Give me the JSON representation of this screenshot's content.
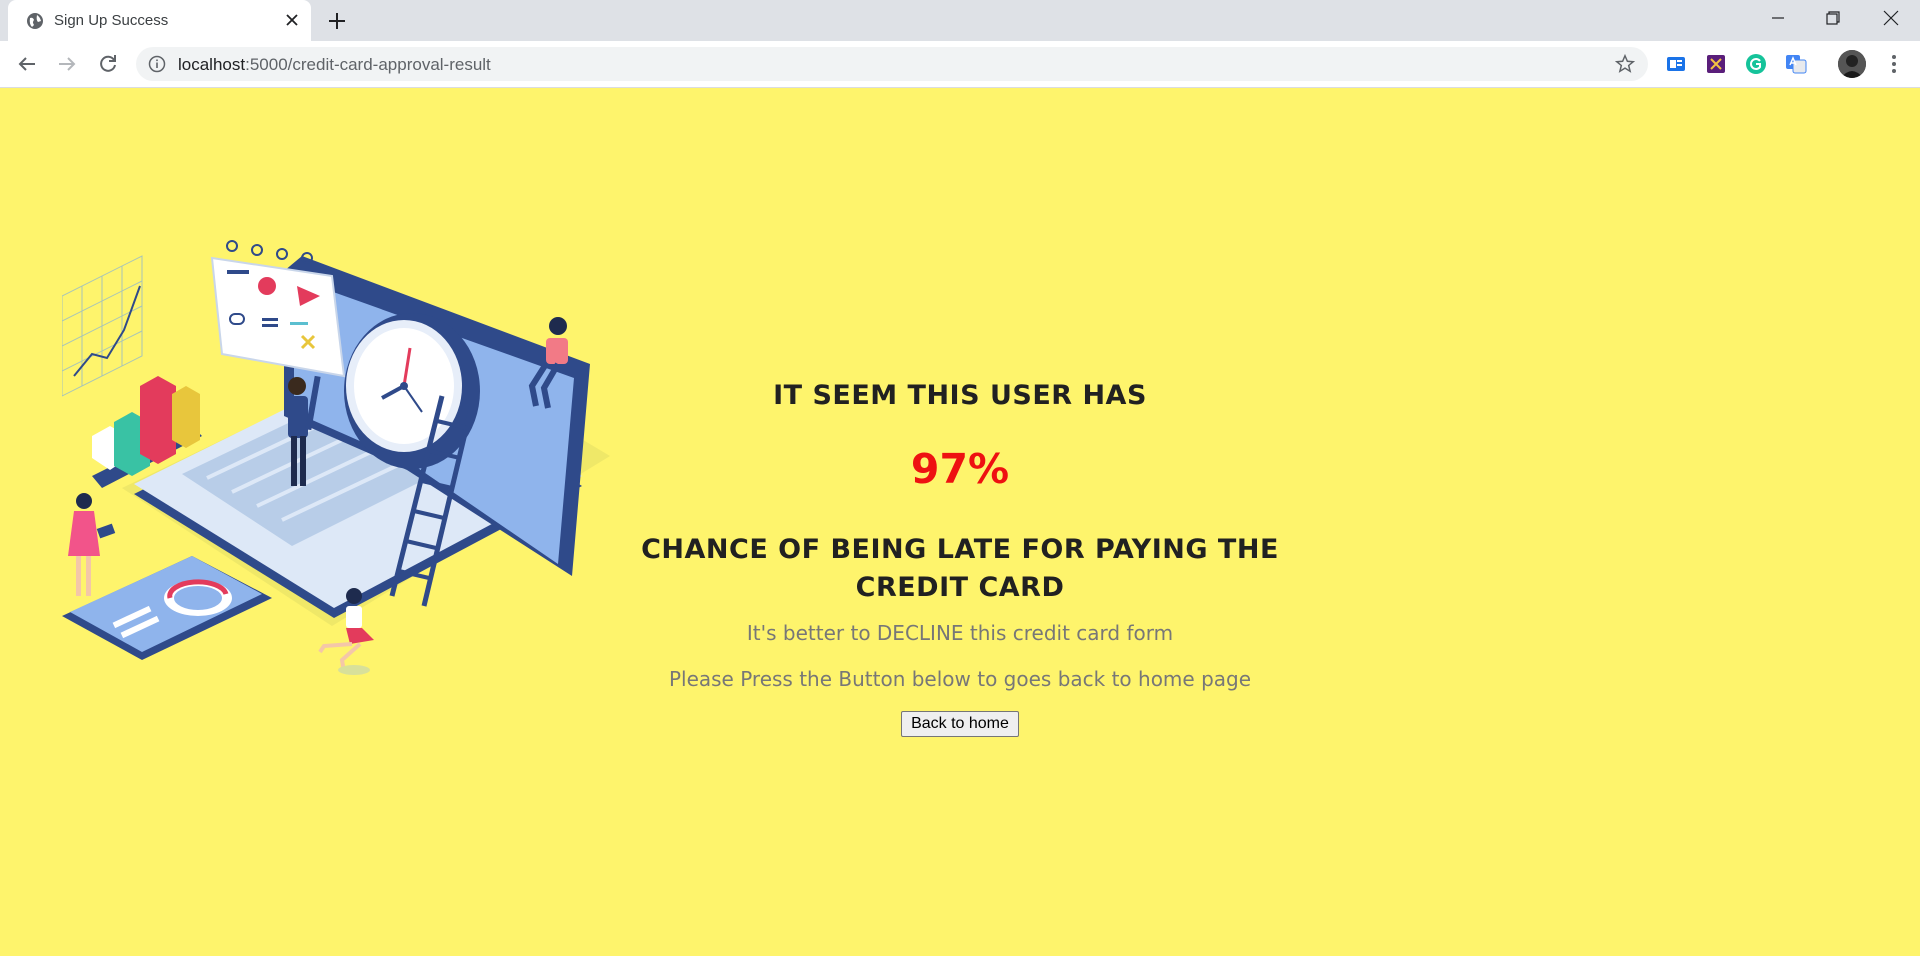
{
  "browser": {
    "tab_title": "Sign Up Success",
    "url_host": "localhost",
    "url_rest": ":5000/credit-card-approval-result"
  },
  "result": {
    "heading_top": "IT SEEM THIS USER HAS",
    "percent": "97%",
    "heading_bottom": "CHANCE OF BEING LATE FOR PAYING THE CREDIT CARD",
    "recommendation": "It's better to DECLINE this credit card form",
    "instruction": "Please Press the Button below to goes back to home page",
    "back_button": "Back to home"
  },
  "colors": {
    "page_background": "#fef46c",
    "percent": "#ee1111"
  }
}
